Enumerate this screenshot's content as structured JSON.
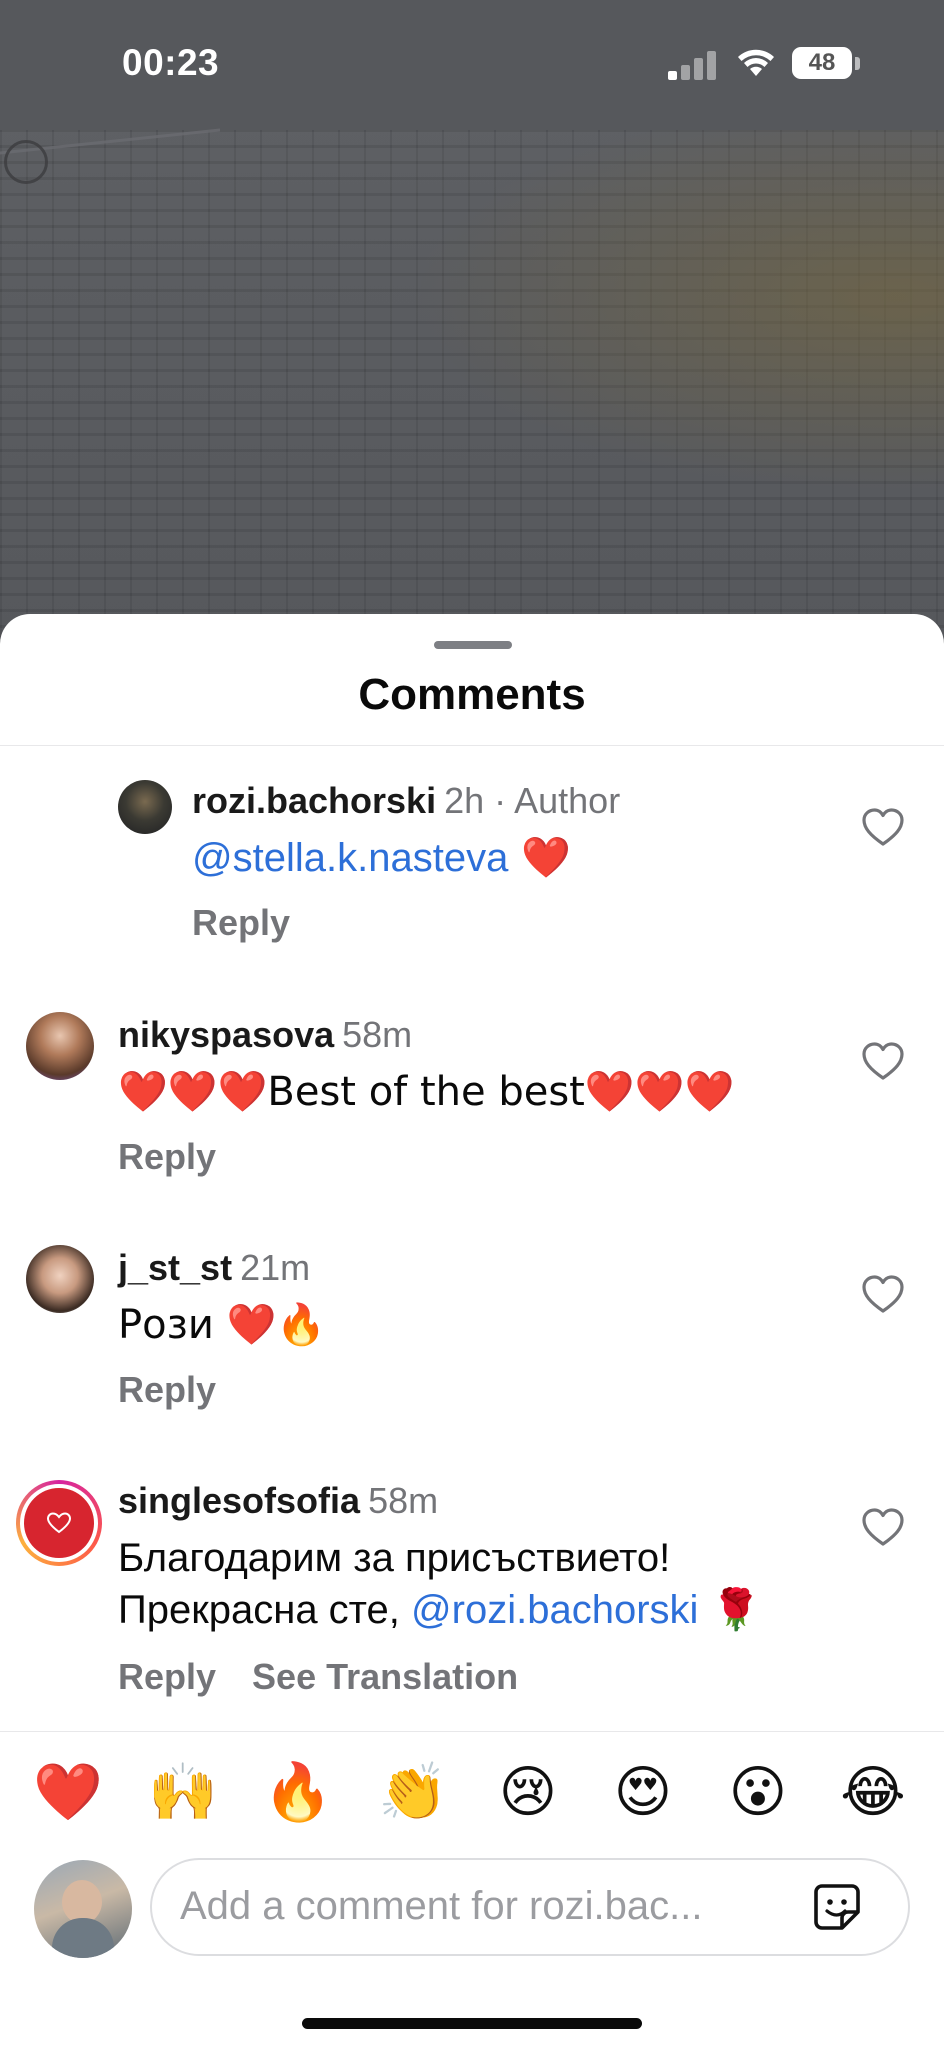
{
  "status_bar": {
    "time": "00:23",
    "battery": "48",
    "icons": [
      "cellular-signal-icon",
      "wifi-icon",
      "battery-icon"
    ]
  },
  "sheet": {
    "title": "Comments"
  },
  "comments": [
    {
      "username": "rozi.bachorski",
      "meta": "2h · Author",
      "mention": "@stella.k.nasteva",
      "text_after": " ❤️",
      "reply_label": "Reply"
    },
    {
      "username": "nikyspasova",
      "meta": "58m",
      "text": "❤️❤️❤️Best of the best❤️❤️❤️",
      "reply_label": "Reply"
    },
    {
      "username": "j_st_st",
      "meta": "21m",
      "text": "Рози ❤️🔥",
      "reply_label": "Reply"
    },
    {
      "username": "singlesofsofia",
      "meta": "58m",
      "line1": "Благодарим за присъствието!",
      "line2_before": "Прекрасна сте, ",
      "mention": "@rozi.bachorski",
      "line2_after": " 🌹",
      "reply_label": "Reply",
      "translation_label": "See Translation"
    }
  ],
  "reactions": [
    "❤️",
    "🙌",
    "🔥",
    "👏",
    "😢",
    "😍",
    "😮",
    "😂"
  ],
  "composer": {
    "placeholder": "Add a comment for rozi.bac..."
  },
  "colors": {
    "mention": "#2d6fd8",
    "secondary_text": "#737478",
    "heart_emoji": "#e0213a"
  }
}
